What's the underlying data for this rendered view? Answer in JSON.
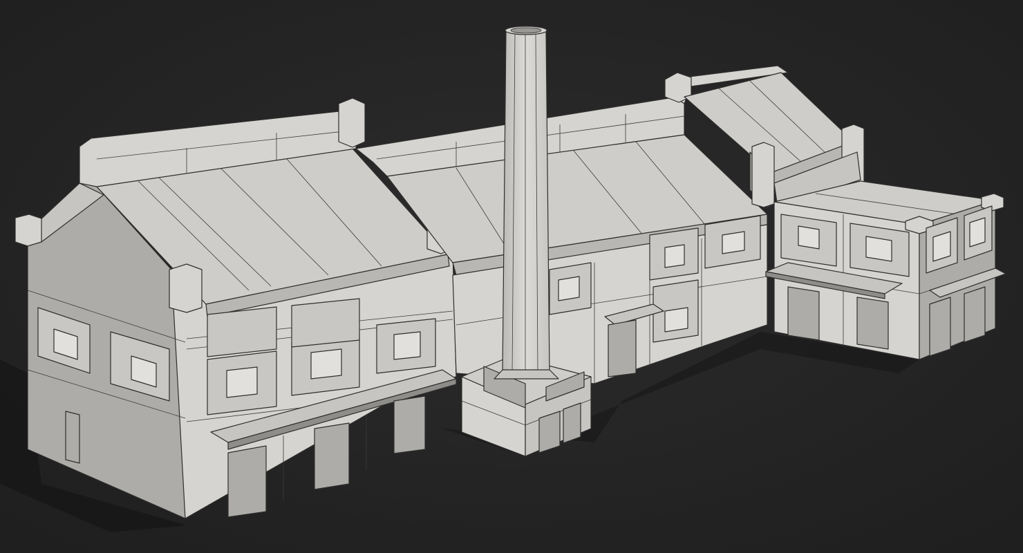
{
  "scene": {
    "background": "#242424",
    "model_color": "#d2d0cc",
    "wire_color": "#2e2e2e"
  }
}
